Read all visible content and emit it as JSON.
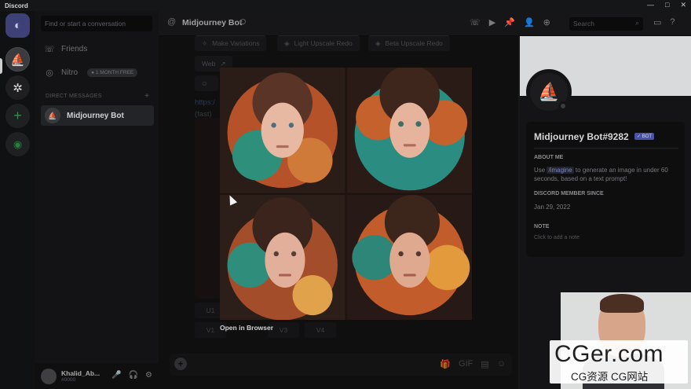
{
  "window": {
    "title": "Discord",
    "controls": [
      "—",
      "□",
      "✕"
    ]
  },
  "servers": [
    {
      "name": "home",
      "glyph": "◐"
    },
    {
      "name": "midjourney",
      "glyph": "⛵"
    },
    {
      "name": "chatgpt",
      "glyph": "✲"
    },
    {
      "name": "add",
      "glyph": "+"
    },
    {
      "name": "explore",
      "glyph": "◉"
    }
  ],
  "sidebar": {
    "search_placeholder": "Find or start a conversation",
    "friends_label": "Friends",
    "nitro_label": "Nitro",
    "nitro_badge": "1 MONTH FREE",
    "dm_header": "DIRECT MESSAGES",
    "dm_add": "+",
    "dm_item": "Midjourney Bot"
  },
  "user": {
    "name": "Khalid_Ab...",
    "tag": "#0000",
    "icons": [
      "🎤",
      "🎧",
      "⚙"
    ]
  },
  "topbar": {
    "at": "@",
    "title": "Midjourney Bot",
    "search_placeholder": "Search",
    "icons": [
      "☏",
      "▶",
      "📌",
      "👤",
      "⊕"
    ],
    "right_icons": [
      "▭",
      "?"
    ]
  },
  "chat": {
    "btn_variations": "Make Variations",
    "btn_light_upscale": "Light Upscale Redo",
    "btn_beta_upscale": "Beta Upscale Redo",
    "btn_web": "Web",
    "link_fragment": "https:/",
    "fast_fragment": "(fast)",
    "u1": "U1",
    "v1": "V1",
    "v3": "V3",
    "v4": "V4"
  },
  "modal": {
    "open_browser": "Open in Browser"
  },
  "composer": {
    "icons": [
      "🎁",
      "GIF",
      "▤",
      "☺"
    ]
  },
  "profile": {
    "name": "Midjourney Bot#9282",
    "badge": "✓ BOT",
    "about_header": "ABOUT ME",
    "about_pre": "Use ",
    "about_cmd": "/imagine",
    "about_post": " to generate an image in under 60 seconds, based on a text prompt!",
    "member_header": "DISCORD MEMBER SINCE",
    "member_date": "Jan 29, 2022",
    "note_header": "NOTE",
    "note_placeholder": "Click to add a note"
  },
  "watermark": {
    "big": "CGer.com",
    "small": "CG资源 CG网站"
  },
  "colors": {
    "accent": "#5865f2",
    "bot_badge": "#4752a8",
    "background": "#0d0d0e"
  }
}
